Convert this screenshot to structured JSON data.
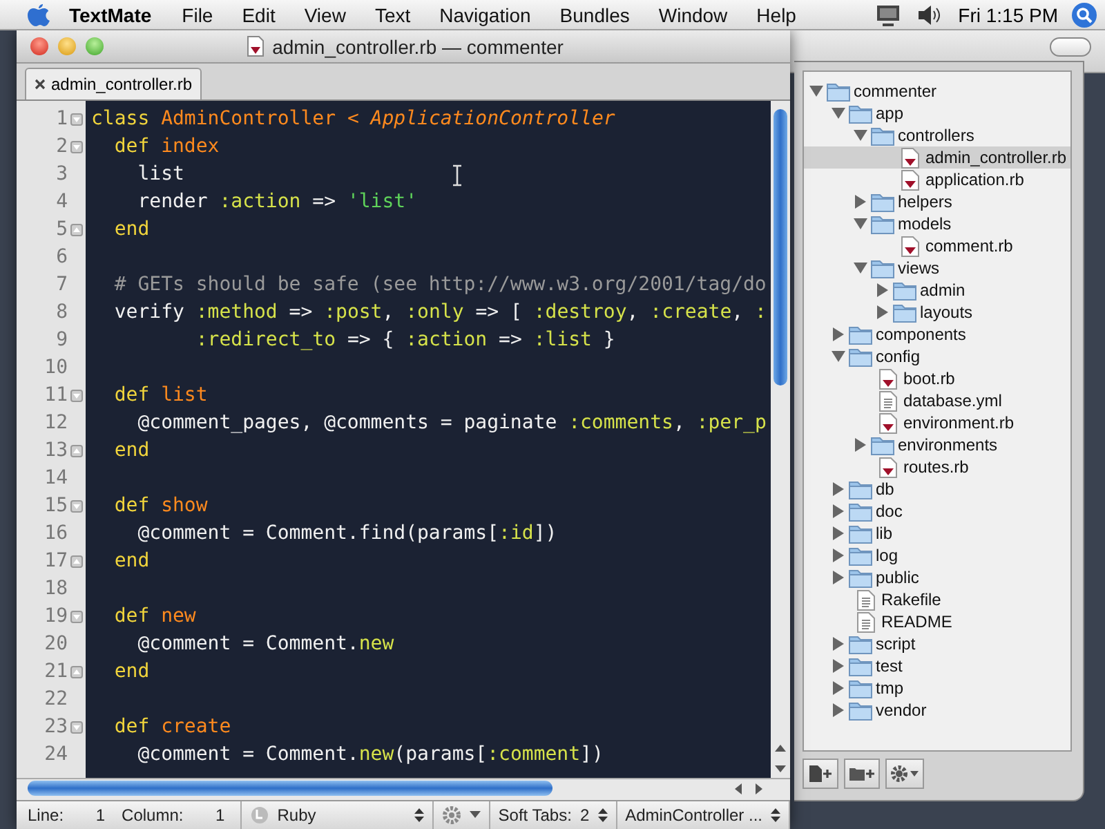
{
  "menu_bar": {
    "app": "TextMate",
    "menus": [
      "File",
      "Edit",
      "View",
      "Text",
      "Navigation",
      "Bundles",
      "Window",
      "Help"
    ],
    "clock": "Fri 1:15 PM"
  },
  "window": {
    "title": "admin_controller.rb — commenter"
  },
  "tabs": [
    {
      "label": "admin_controller.rb",
      "selected": true
    }
  ],
  "code": [
    {
      "num": "1",
      "fold_start": true,
      "tokens": [
        {
          "kind": "keyword",
          "text": "class "
        },
        {
          "kind": "name",
          "text": "AdminController"
        },
        {
          "kind": "inherit",
          "text": " < ApplicationController"
        }
      ]
    },
    {
      "num": "2",
      "fold_start": true,
      "tokens": [
        {
          "kind": "keyword",
          "text": "  def "
        },
        {
          "kind": "name",
          "text": "index"
        }
      ]
    },
    {
      "num": "3",
      "tokens": [
        {
          "kind": "plain",
          "text": "    list"
        }
      ]
    },
    {
      "num": "4",
      "tokens": [
        {
          "kind": "plain",
          "text": "    render "
        },
        {
          "kind": "symbol",
          "text": ":action"
        },
        {
          "kind": "plain",
          "text": " => "
        },
        {
          "kind": "string",
          "text": "'list'"
        }
      ]
    },
    {
      "num": "5",
      "fold_end": true,
      "tokens": [
        {
          "kind": "keyword",
          "text": "  end"
        }
      ]
    },
    {
      "num": "6"
    },
    {
      "num": "7",
      "tokens": [
        {
          "kind": "comment",
          "text": "  # GETs should be safe (see http://www.w3.org/2001/tag/do"
        }
      ]
    },
    {
      "num": "8",
      "tokens": [
        {
          "kind": "plain",
          "text": "  verify "
        },
        {
          "kind": "symbol",
          "text": ":method"
        },
        {
          "kind": "plain",
          "text": " => "
        },
        {
          "kind": "symbol",
          "text": ":post"
        },
        {
          "kind": "plain",
          "text": ", "
        },
        {
          "kind": "symbol",
          "text": ":only"
        },
        {
          "kind": "plain",
          "text": " => [ "
        },
        {
          "kind": "symbol",
          "text": ":destroy"
        },
        {
          "kind": "plain",
          "text": ", "
        },
        {
          "kind": "symbol",
          "text": ":create"
        },
        {
          "kind": "plain",
          "text": ", "
        },
        {
          "kind": "symbol",
          "text": ":"
        }
      ]
    },
    {
      "num": "9",
      "tokens": [
        {
          "kind": "symbol",
          "text": "         :redirect_to"
        },
        {
          "kind": "plain",
          "text": " => { "
        },
        {
          "kind": "symbol",
          "text": ":action"
        },
        {
          "kind": "plain",
          "text": " => "
        },
        {
          "kind": "symbol",
          "text": ":list"
        },
        {
          "kind": "plain",
          "text": " }"
        }
      ]
    },
    {
      "num": "10"
    },
    {
      "num": "11",
      "fold_start": true,
      "tokens": [
        {
          "kind": "keyword",
          "text": "  def "
        },
        {
          "kind": "name",
          "text": "list"
        }
      ]
    },
    {
      "num": "12",
      "tokens": [
        {
          "kind": "plain",
          "text": "    @comment_pages, @comments = paginate "
        },
        {
          "kind": "symbol",
          "text": ":comments"
        },
        {
          "kind": "plain",
          "text": ", "
        },
        {
          "kind": "symbol",
          "text": ":per_p"
        }
      ]
    },
    {
      "num": "13",
      "fold_end": true,
      "tokens": [
        {
          "kind": "keyword",
          "text": "  end"
        }
      ]
    },
    {
      "num": "14"
    },
    {
      "num": "15",
      "fold_start": true,
      "tokens": [
        {
          "kind": "keyword",
          "text": "  def "
        },
        {
          "kind": "name",
          "text": "show"
        }
      ]
    },
    {
      "num": "16",
      "tokens": [
        {
          "kind": "plain",
          "text": "    @comment = Comment.find(params["
        },
        {
          "kind": "symbol",
          "text": ":id"
        },
        {
          "kind": "plain",
          "text": "])"
        }
      ]
    },
    {
      "num": "17",
      "fold_end": true,
      "tokens": [
        {
          "kind": "keyword",
          "text": "  end"
        }
      ]
    },
    {
      "num": "18"
    },
    {
      "num": "19",
      "fold_start": true,
      "tokens": [
        {
          "kind": "keyword",
          "text": "  def "
        },
        {
          "kind": "name",
          "text": "new"
        }
      ]
    },
    {
      "num": "20",
      "tokens": [
        {
          "kind": "plain",
          "text": "    @comment = Comment."
        },
        {
          "kind": "symbol",
          "text": "new"
        }
      ]
    },
    {
      "num": "21",
      "fold_end": true,
      "tokens": [
        {
          "kind": "keyword",
          "text": "  end"
        }
      ]
    },
    {
      "num": "22"
    },
    {
      "num": "23",
      "fold_start": true,
      "tokens": [
        {
          "kind": "keyword",
          "text": "  def "
        },
        {
          "kind": "name",
          "text": "create"
        }
      ]
    },
    {
      "num": "24",
      "tokens": [
        {
          "kind": "plain",
          "text": "    @comment = Comment."
        },
        {
          "kind": "symbol",
          "text": "new"
        },
        {
          "kind": "plain",
          "text": "(params["
        },
        {
          "kind": "symbol",
          "text": ":comment"
        },
        {
          "kind": "plain",
          "text": "])"
        }
      ]
    }
  ],
  "status_bar": {
    "line_label": "Line:",
    "line": "1",
    "column_label": "Column:",
    "column": "1",
    "language": "Ruby",
    "tabs_label": "Soft Tabs:",
    "tabs": "2",
    "symbol": "AdminController ..."
  },
  "project": [
    {
      "label": "commenter",
      "kind": "folder",
      "expanded": true,
      "selected": false,
      "children": [
        {
          "label": "app",
          "kind": "folder",
          "expanded": true,
          "selected": false,
          "children": [
            {
              "label": "controllers",
              "kind": "folder",
              "expanded": true,
              "selected": false,
              "children": [
                {
                  "label": "admin_controller.rb",
                  "kind": "ruby",
                  "selected": true
                },
                {
                  "label": "application.rb",
                  "kind": "ruby",
                  "selected": false
                }
              ]
            },
            {
              "label": "helpers",
              "kind": "folder",
              "expanded": false,
              "selected": false
            },
            {
              "label": "models",
              "kind": "folder",
              "expanded": true,
              "selected": false,
              "children": [
                {
                  "label": "comment.rb",
                  "kind": "ruby",
                  "selected": false
                }
              ]
            },
            {
              "label": "views",
              "kind": "folder",
              "expanded": true,
              "selected": false,
              "children": [
                {
                  "label": "admin",
                  "kind": "folder",
                  "expanded": false,
                  "selected": false
                },
                {
                  "label": "layouts",
                  "kind": "folder",
                  "expanded": false,
                  "selected": false
                }
              ]
            }
          ]
        },
        {
          "label": "components",
          "kind": "folder",
          "expanded": false,
          "selected": false
        },
        {
          "label": "config",
          "kind": "folder",
          "expanded": true,
          "selected": false,
          "children": [
            {
              "label": "boot.rb",
              "kind": "ruby",
              "selected": false
            },
            {
              "label": "database.yml",
              "kind": "text",
              "selected": false
            },
            {
              "label": "environment.rb",
              "kind": "ruby",
              "selected": false
            },
            {
              "label": "environments",
              "kind": "folder",
              "expanded": false,
              "selected": false
            },
            {
              "label": "routes.rb",
              "kind": "ruby",
              "selected": false
            }
          ]
        },
        {
          "label": "db",
          "kind": "folder",
          "expanded": false,
          "selected": false
        },
        {
          "label": "doc",
          "kind": "folder",
          "expanded": false,
          "selected": false
        },
        {
          "label": "lib",
          "kind": "folder",
          "expanded": false,
          "selected": false
        },
        {
          "label": "log",
          "kind": "folder",
          "expanded": false,
          "selected": false
        },
        {
          "label": "public",
          "kind": "folder",
          "expanded": false,
          "selected": false
        },
        {
          "label": "Rakefile",
          "kind": "text",
          "selected": false
        },
        {
          "label": "README",
          "kind": "text",
          "selected": false
        },
        {
          "label": "script",
          "kind": "folder",
          "expanded": false,
          "selected": false
        },
        {
          "label": "test",
          "kind": "folder",
          "expanded": false,
          "selected": false
        },
        {
          "label": "tmp",
          "kind": "folder",
          "expanded": false,
          "selected": false
        },
        {
          "label": "vendor",
          "kind": "folder",
          "expanded": false,
          "selected": false
        }
      ]
    }
  ]
}
